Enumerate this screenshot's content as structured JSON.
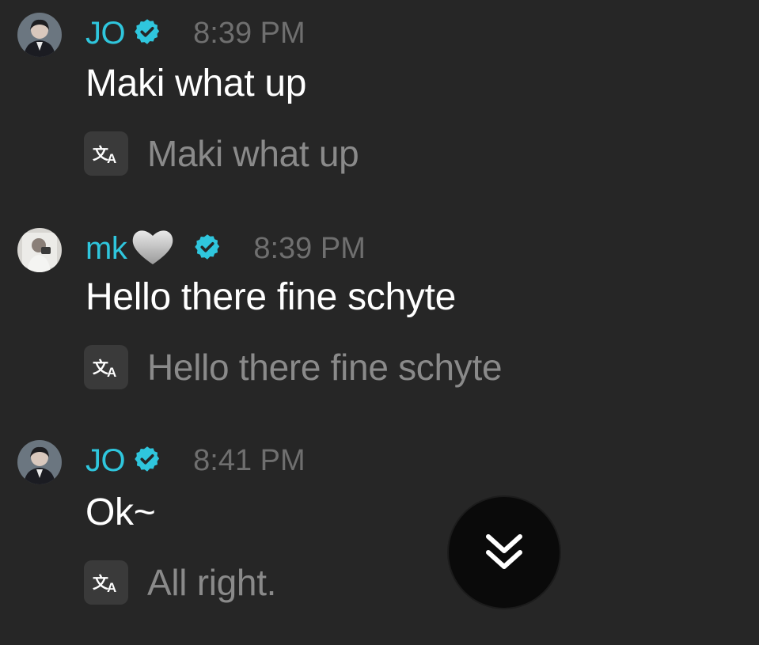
{
  "colors": {
    "background": "#262626",
    "username": "#2fc6dd",
    "verified_badge": "#2fc6dd",
    "timestamp": "#6f6f6f",
    "message_text": "#ffffff",
    "translation_text": "#8a8a8a",
    "scroll_button": "#0a0a0a"
  },
  "messages": [
    {
      "username": "JO",
      "verified": true,
      "heart_emoji": "",
      "time": "8:39 PM",
      "text": "Maki what up",
      "translation": "Maki what up",
      "avatar_icon": "avatar-dark-suit-icon"
    },
    {
      "username": "mk",
      "verified": true,
      "heart_emoji": "🩶",
      "time": "8:39 PM",
      "text": "Hello there fine schyte",
      "translation": "Hello there fine schyte",
      "avatar_icon": "avatar-light-photo-icon"
    },
    {
      "username": "JO",
      "verified": true,
      "heart_emoji": "",
      "time": "8:41 PM",
      "text": "Ok~",
      "translation": "All right.",
      "avatar_icon": "avatar-dark-suit-icon"
    }
  ],
  "icons": {
    "translate": "translate-icon",
    "verified": "verified-badge-icon",
    "scroll_down": "double-chevron-down-icon"
  }
}
